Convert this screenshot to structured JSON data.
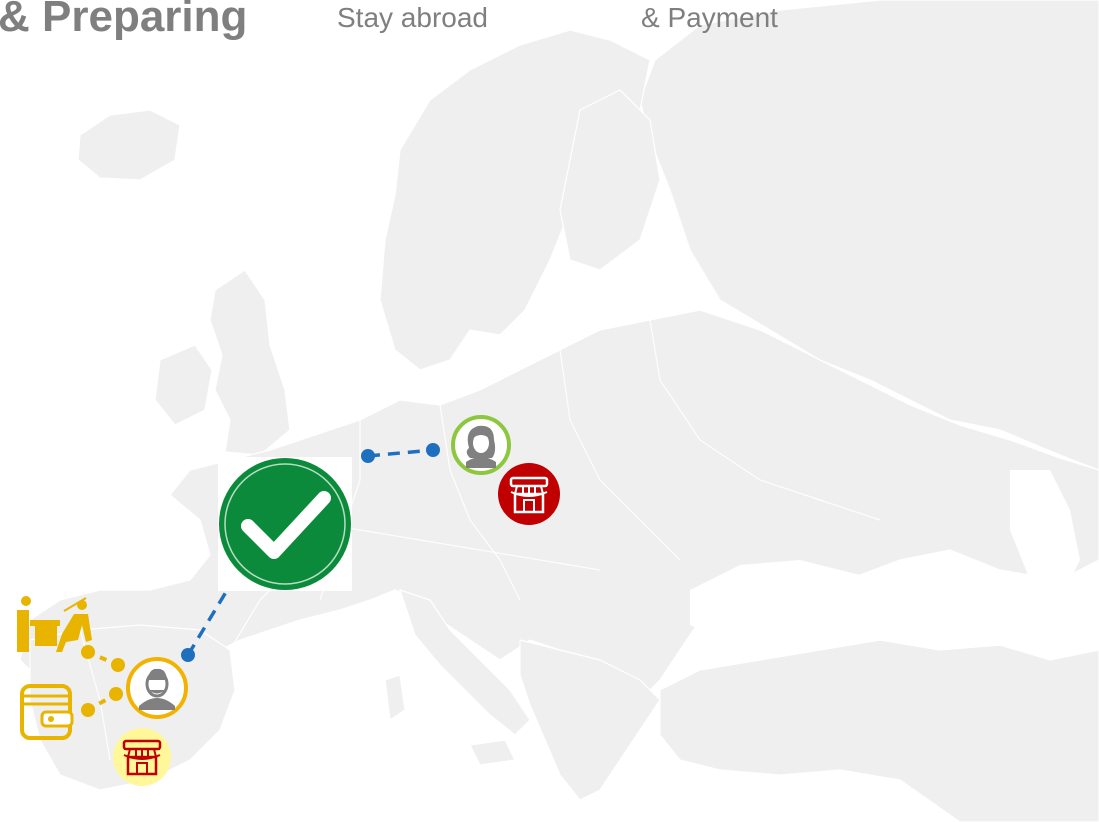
{
  "header": {
    "title": "& Preparing",
    "step_stay_abroad": "Stay abroad",
    "step_payment": "& Payment"
  },
  "colors": {
    "map_fill": "#efefef",
    "map_border": "#ffffff",
    "route_dashes": "#1f6fbf",
    "origin_connector": "#e8b400",
    "origin_ring": "#f2b300",
    "destination_ring": "#8dc63f",
    "checkmark_badge": "#0a8a3a",
    "shop_red": "#c00000",
    "shop_yellow_bg": "#fff799",
    "icon_gold": "#e8b400",
    "title_text": "#7f7f7f"
  },
  "icons": {
    "check_badge": "check-circle-icon",
    "origin_person": "male-person-icon",
    "destination_person": "female-person-icon",
    "origin_shop": "storefront-icon",
    "destination_shop": "storefront-icon",
    "meeting": "meeting-desk-icon",
    "wallet": "wallet-icon"
  }
}
